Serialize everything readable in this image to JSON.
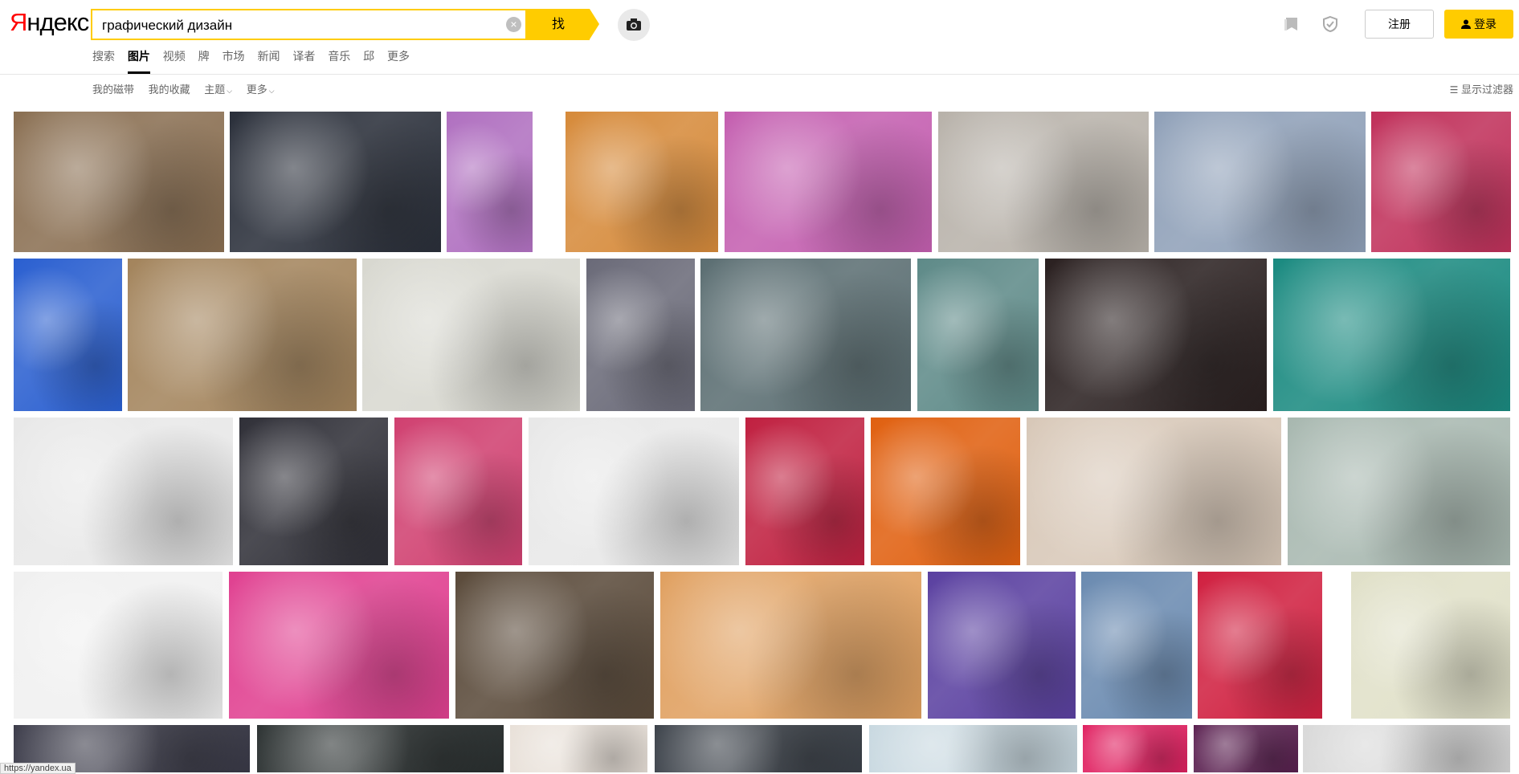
{
  "header": {
    "logo_first": "Я",
    "logo_rest": "ндекс",
    "search_value": "графический дизайн",
    "clear_label": "×",
    "search_button": "找",
    "register": "注册",
    "login": "登录"
  },
  "nav": [
    "搜索",
    "图片",
    "视频",
    "牌",
    "市场",
    "新闻",
    "译者",
    "音乐",
    "邱",
    "更多"
  ],
  "subnav": {
    "my_tape": "我的磁带",
    "favorites": "我的收藏",
    "topics": "主题",
    "more": "更多",
    "filters": "显示过滤器"
  },
  "status_url": "https://yandex.ua",
  "tile_colors": {
    "row1": [
      "#8a6f52",
      "#2a2f3a",
      "#b070c0",
      "#d68a3a",
      "#c45fb0",
      "#b8b2aa",
      "#8fa0b8",
      "#c0305a"
    ],
    "row2": [
      "#2a5fd0",
      "#a3845c",
      "#d8d8d0",
      "#6a6a78",
      "#5b6e72",
      "#5e8a88",
      "#2a2020",
      "#1a8a80"
    ],
    "row3": [
      "#e8e8e8",
      "#303038",
      "#d04070",
      "#e8e8e8",
      "#c02040",
      "#e06010",
      "#d8c8b8",
      "#a8b8b0"
    ],
    "row4": [
      "#f0f0f0",
      "#e04090",
      "#5a4a3a",
      "#e0a060",
      "#5a40a0",
      "#6a8ab0",
      "#d02040",
      "#e0e0c8"
    ],
    "row5": [
      "#3a3a48",
      "#2a3030",
      "#e8e0d8",
      "#3a4048",
      "#c8d8e0",
      "#e02060",
      "#5a2050",
      "#d8d8d8"
    ]
  }
}
